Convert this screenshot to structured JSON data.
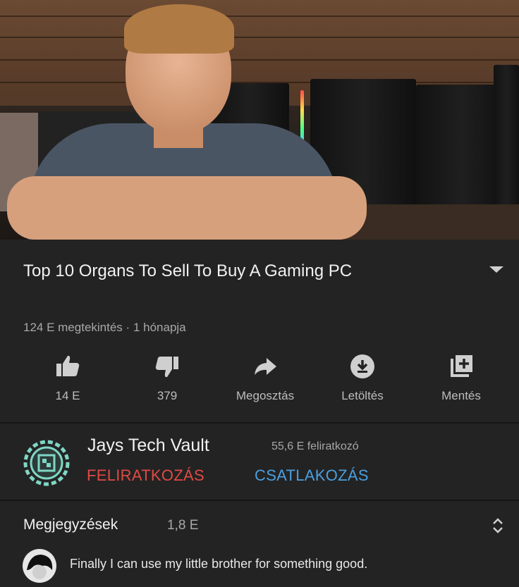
{
  "video": {
    "title": "Top 10 Organs To Sell To Buy A Gaming PC",
    "views": "124 E megtekintés",
    "separator": "·",
    "age": "1 hónapja"
  },
  "actions": [
    {
      "name": "like",
      "icon": "thumb-up-icon",
      "label": "14 E"
    },
    {
      "name": "dislike",
      "icon": "thumb-down-icon",
      "label": "379"
    },
    {
      "name": "share",
      "icon": "share-icon",
      "label": "Megosztás"
    },
    {
      "name": "download",
      "icon": "download-icon",
      "label": "Letöltés"
    },
    {
      "name": "save",
      "icon": "playlist-add-icon",
      "label": "Mentés"
    }
  ],
  "channel": {
    "name": "Jays Tech Vault",
    "subscribers": "55,6 E feliratkozó",
    "subscribe_label": "FELIRATKOZÁS",
    "join_label": "CSATLAKOZÁS",
    "subscribe_color": "#e04a44",
    "join_color": "#4a9fe0"
  },
  "comments": {
    "title": "Megjegyzések",
    "count": "1,8 E",
    "top_comment": "Finally I can use my little brother for something good."
  },
  "theme": {
    "background": "#232323",
    "text": "#f1f1f1",
    "muted": "#a8a8a8"
  }
}
